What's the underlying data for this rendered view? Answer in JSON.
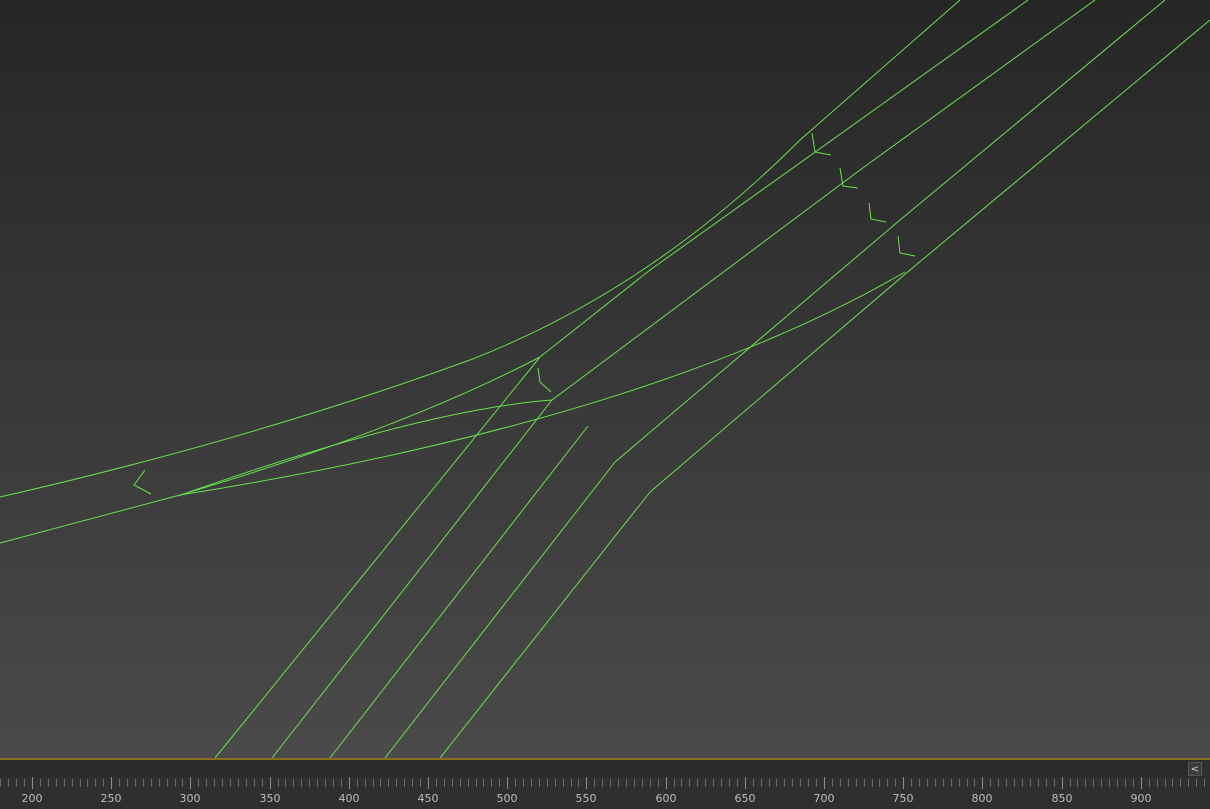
{
  "viewport": {
    "background": "#333333",
    "wire_color": "#66e34a"
  },
  "timeline": {
    "collapse_button_label": "<",
    "ruler_labels": [
      "200",
      "250",
      "300",
      "350",
      "400",
      "450",
      "500",
      "550",
      "600",
      "650",
      "700",
      "750",
      "800",
      "850",
      "900"
    ],
    "border_color": "#8a6d1e"
  }
}
